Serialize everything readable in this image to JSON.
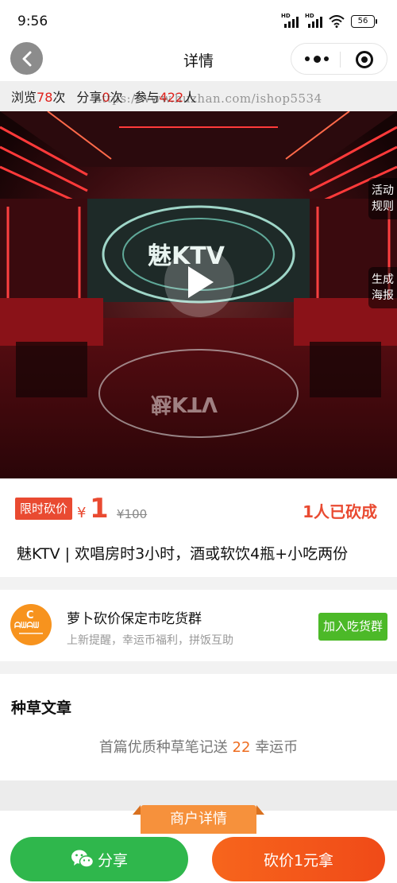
{
  "status_bar": {
    "time": "9:56",
    "signal_1": "HD",
    "signal_2": "HD",
    "battery": "56"
  },
  "nav": {
    "title": "详情"
  },
  "stats": {
    "views_prefix": "浏览",
    "views": "78",
    "views_suffix": "次",
    "shares_prefix": "分享",
    "shares": "0",
    "shares_suffix": "次",
    "participants_prefix": "参与",
    "participants": "422",
    "participants_suffix": "人"
  },
  "watermark": "https://www.huzhan.com/ishop5534",
  "video": {
    "side_tabs": [
      {
        "line1": "活动",
        "line2": "规则"
      },
      {
        "line1": "生成",
        "line2": "海报"
      }
    ],
    "sign_text": "魅KTV",
    "sign_reflection": "魅KTV"
  },
  "price": {
    "tag": "限时砍价",
    "currency": "¥",
    "value": "1",
    "original": "¥100",
    "cut_count": "1人已砍成"
  },
  "product": {
    "title": "魅KTV | 欢唱房时3小时，酒或软饮4瓶+小吃两份"
  },
  "group": {
    "logo_mark": "C",
    "logo_text": "ᗩᗯᗩᗯ",
    "name": "萝卜砍价保定市吃货群",
    "desc": "上新提醒，幸运币福利，拼饭互助",
    "join_label": "加入吃货群"
  },
  "article": {
    "title": "种草文章",
    "note_prefix": "首篇优质种草笔记送",
    "note_amount": "22",
    "note_suffix": "幸运币"
  },
  "merchant_tab": "商户详情",
  "actions": {
    "share_label": "分享",
    "bargain_label": "砍价1元拿"
  },
  "colors": {
    "accent_red": "#e94a31",
    "share_green": "#2fb74c",
    "bargain_orange": "#f7651c",
    "join_green": "#4cb928",
    "merchant_orange": "#f6913c"
  }
}
